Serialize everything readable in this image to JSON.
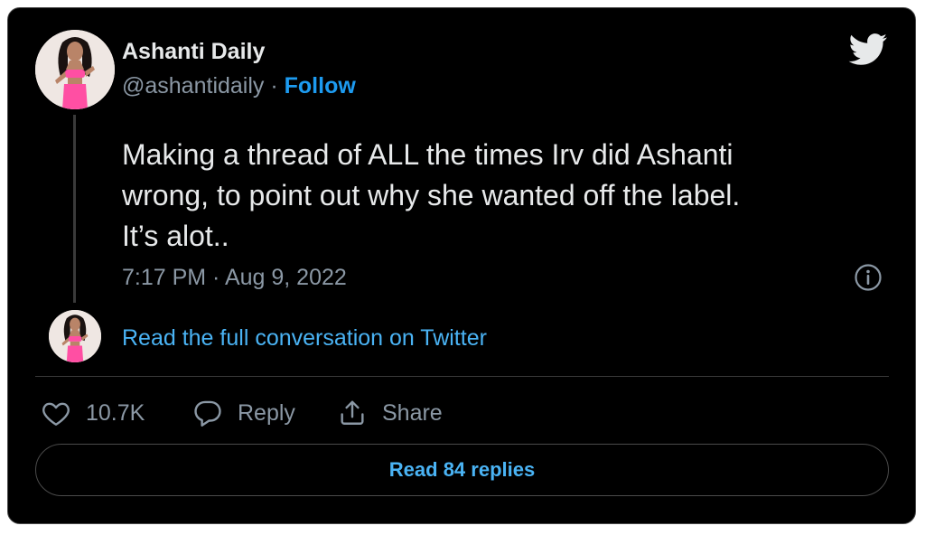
{
  "colors": {
    "card_background": "#000000",
    "primary_text": "#e7e9ea",
    "secondary_text": "#8b98a5",
    "accent_blue": "#1d9bf0",
    "link_blue": "#4ab3f4",
    "border": "#4a4a4a",
    "avatar_outfit_pink": "#ff4fa3"
  },
  "icons": {
    "brand": "twitter-bird-icon",
    "info": "info-icon",
    "like": "heart-icon",
    "reply": "speech-bubble-icon",
    "share": "share-upload-icon"
  },
  "author": {
    "display_name": "Ashanti Daily",
    "handle": "@ashantidaily",
    "separator": " · ",
    "follow_label": "Follow"
  },
  "tweet": {
    "text": "Making a thread of ALL the times Irv did Ashanti\nwrong, to point out why she wanted off the label.\nIt’s alot..",
    "timestamp": "7:17 PM · Aug 9, 2022"
  },
  "thread": {
    "read_full_label": "Read the full conversation on Twitter"
  },
  "actions": {
    "like_count": "10.7K",
    "reply_label": "Reply",
    "share_label": "Share"
  },
  "footer": {
    "read_replies_label": "Read 84 replies"
  }
}
